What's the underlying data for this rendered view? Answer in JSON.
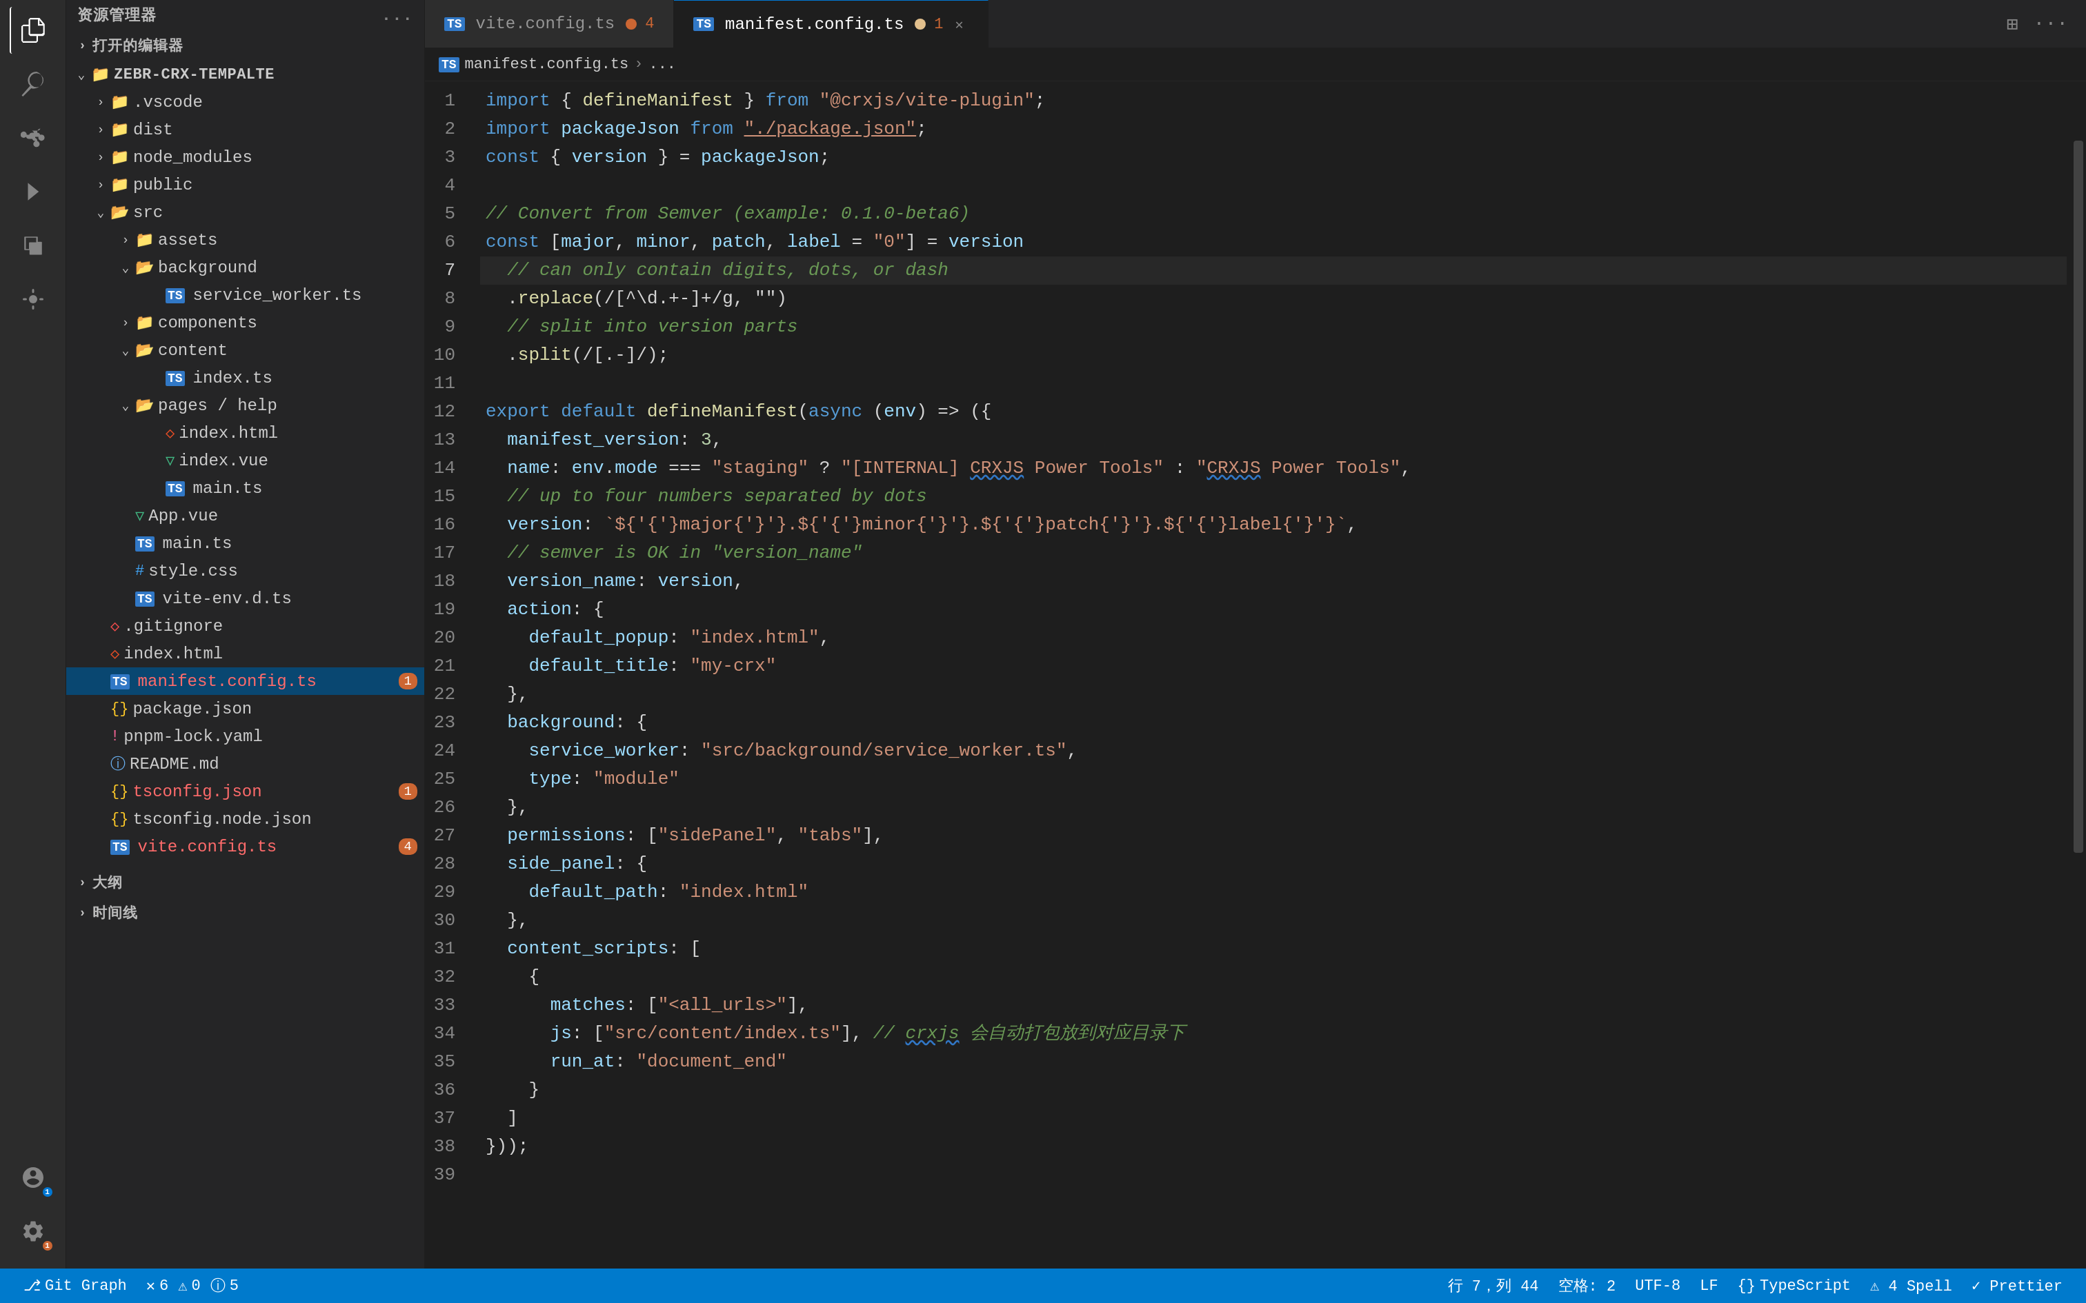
{
  "titleBar": {
    "explorerLabel": "资源管理器",
    "moreButton": "...",
    "openedFilesLabel": "打开的编辑器"
  },
  "sidebar": {
    "rootName": "ZEBR-CRX-TEMPALTE",
    "items": [
      {
        "id": "vscode",
        "label": ".vscode",
        "type": "folder",
        "indent": 1,
        "open": false
      },
      {
        "id": "dist",
        "label": "dist",
        "type": "folder",
        "indent": 1,
        "open": false
      },
      {
        "id": "node_modules",
        "label": "node_modules",
        "type": "folder",
        "indent": 1,
        "open": false
      },
      {
        "id": "public",
        "label": "public",
        "type": "folder",
        "indent": 1,
        "open": false
      },
      {
        "id": "src",
        "label": "src",
        "type": "folder",
        "indent": 1,
        "open": true
      },
      {
        "id": "assets",
        "label": "assets",
        "type": "folder",
        "indent": 2,
        "open": false
      },
      {
        "id": "background",
        "label": "background",
        "type": "folder",
        "indent": 2,
        "open": true
      },
      {
        "id": "service_worker.ts",
        "label": "service_worker.ts",
        "type": "ts",
        "indent": 3,
        "open": false
      },
      {
        "id": "components",
        "label": "components",
        "type": "folder",
        "indent": 2,
        "open": false
      },
      {
        "id": "content",
        "label": "content",
        "type": "folder",
        "indent": 2,
        "open": true
      },
      {
        "id": "index.ts",
        "label": "index.ts",
        "type": "ts",
        "indent": 3,
        "open": false
      },
      {
        "id": "pages_help",
        "label": "pages / help",
        "type": "folder",
        "indent": 2,
        "open": true
      },
      {
        "id": "index.html_pages",
        "label": "index.html",
        "type": "html",
        "indent": 3,
        "open": false
      },
      {
        "id": "index.vue",
        "label": "index.vue",
        "type": "vue",
        "indent": 3,
        "open": false
      },
      {
        "id": "main.ts_help",
        "label": "main.ts",
        "type": "ts",
        "indent": 3,
        "open": false
      },
      {
        "id": "App.vue",
        "label": "App.vue",
        "type": "vue",
        "indent": 2,
        "open": false
      },
      {
        "id": "main.ts",
        "label": "main.ts",
        "type": "ts",
        "indent": 2,
        "open": false
      },
      {
        "id": "style.css",
        "label": "style.css",
        "type": "css",
        "indent": 2,
        "open": false
      },
      {
        "id": "vite-env.d.ts",
        "label": "vite-env.d.ts",
        "type": "ts",
        "indent": 2,
        "open": false
      },
      {
        "id": ".gitignore",
        "label": ".gitignore",
        "type": "git",
        "indent": 1,
        "open": false
      },
      {
        "id": "index.html",
        "label": "index.html",
        "type": "html",
        "indent": 1,
        "open": false
      },
      {
        "id": "manifest.config.ts",
        "label": "manifest.config.ts",
        "type": "ts",
        "indent": 1,
        "open": false,
        "active": true,
        "badge": "1"
      },
      {
        "id": "package.json",
        "label": "package.json",
        "type": "json",
        "indent": 1,
        "open": false
      },
      {
        "id": "pnpm-lock.yaml",
        "label": "pnpm-lock.yaml",
        "type": "yaml",
        "indent": 1,
        "open": false
      },
      {
        "id": "README.md",
        "label": "README.md",
        "type": "info",
        "indent": 1,
        "open": false
      },
      {
        "id": "tsconfig.json",
        "label": "tsconfig.json",
        "type": "json",
        "indent": 1,
        "open": false,
        "badge": "1"
      },
      {
        "id": "tsconfig.node.json",
        "label": "tsconfig.node.json",
        "type": "json",
        "indent": 1,
        "open": false
      },
      {
        "id": "vite.config.ts",
        "label": "vite.config.ts",
        "type": "ts",
        "indent": 1,
        "open": false,
        "badge": "4"
      }
    ],
    "outline": "大纲",
    "timeline": "时间线"
  },
  "tabs": [
    {
      "id": "vite.config.ts",
      "label": "vite.config.ts",
      "type": "ts",
      "badge": "4",
      "active": false
    },
    {
      "id": "manifest.config.ts",
      "label": "manifest.config.ts",
      "type": "ts",
      "badge": "1",
      "active": true,
      "modified": true
    }
  ],
  "breadcrumb": {
    "parts": [
      "TS manifest.config.ts",
      ">",
      "..."
    ]
  },
  "editor": {
    "lines": [
      {
        "num": 1,
        "tokens": [
          {
            "t": "kw",
            "v": "import"
          },
          {
            "t": "op",
            "v": " { "
          },
          {
            "t": "fn",
            "v": "defineManifest"
          },
          {
            "t": "op",
            "v": " } "
          },
          {
            "t": "kw",
            "v": "from"
          },
          {
            "t": "op",
            "v": " "
          },
          {
            "t": "str",
            "v": "\"@crxjs/vite-plugin\""
          },
          {
            "t": "op",
            "v": ";"
          }
        ]
      },
      {
        "num": 2,
        "tokens": [
          {
            "t": "kw",
            "v": "import"
          },
          {
            "t": "op",
            "v": " "
          },
          {
            "t": "var",
            "v": "packageJson"
          },
          {
            "t": "op",
            "v": " "
          },
          {
            "t": "kw",
            "v": "from"
          },
          {
            "t": "op",
            "v": " "
          },
          {
            "t": "str",
            "v": "\"./package.json\""
          },
          {
            "t": "op",
            "v": ";"
          }
        ]
      },
      {
        "num": 3,
        "tokens": [
          {
            "t": "kw",
            "v": "const"
          },
          {
            "t": "op",
            "v": " { "
          },
          {
            "t": "var",
            "v": "version"
          },
          {
            "t": "op",
            "v": " } = "
          },
          {
            "t": "var",
            "v": "packageJson"
          },
          {
            "t": "op",
            "v": ";"
          }
        ]
      },
      {
        "num": 4,
        "tokens": []
      },
      {
        "num": 5,
        "tokens": [
          {
            "t": "cmt",
            "v": "// Convert from Semver (example: 0.1.0-beta6)"
          }
        ]
      },
      {
        "num": 6,
        "tokens": [
          {
            "t": "kw",
            "v": "const"
          },
          {
            "t": "op",
            "v": " ["
          },
          {
            "t": "var",
            "v": "major"
          },
          {
            "t": "op",
            "v": ", "
          },
          {
            "t": "var",
            "v": "minor"
          },
          {
            "t": "op",
            "v": ", "
          },
          {
            "t": "var",
            "v": "patch"
          },
          {
            "t": "op",
            "v": ", "
          },
          {
            "t": "var",
            "v": "label"
          },
          {
            "t": "op",
            "v": " = "
          },
          {
            "t": "str",
            "v": "\"0\""
          },
          {
            "t": "op",
            "v": "] = "
          },
          {
            "t": "var",
            "v": "version"
          }
        ]
      },
      {
        "num": 7,
        "tokens": [
          {
            "t": "cmt",
            "v": "  // can only contain digits, dots, or dash"
          }
        ],
        "highlighted": true
      },
      {
        "num": 8,
        "tokens": [
          {
            "t": "op",
            "v": "  ."
          },
          {
            "t": "fn",
            "v": "replace"
          },
          {
            "t": "op",
            "v": "(/[^\\d."
          },
          {
            "t": "op",
            "v": "-"
          },
          {
            "t": "op",
            "v": "]+/g, \"\")"
          }
        ]
      },
      {
        "num": 9,
        "tokens": [
          {
            "t": "cmt",
            "v": "  // split into version parts"
          }
        ]
      },
      {
        "num": 10,
        "tokens": [
          {
            "t": "op",
            "v": "  ."
          },
          {
            "t": "fn",
            "v": "split"
          },
          {
            "t": "op",
            "v": "(/[."
          },
          {
            "t": "op",
            "v": "-"
          },
          {
            "t": "op",
            "v": "]/);"
          }
        ]
      },
      {
        "num": 11,
        "tokens": []
      },
      {
        "num": 12,
        "tokens": [
          {
            "t": "kw",
            "v": "export"
          },
          {
            "t": "op",
            "v": " "
          },
          {
            "t": "kw",
            "v": "default"
          },
          {
            "t": "op",
            "v": " "
          },
          {
            "t": "fn",
            "v": "defineManifest"
          },
          {
            "t": "op",
            "v": "("
          },
          {
            "t": "kw",
            "v": "async"
          },
          {
            "t": "op",
            "v": " ("
          },
          {
            "t": "var",
            "v": "env"
          },
          {
            "t": "op",
            "v": ") => ({"
          }
        ]
      },
      {
        "num": 13,
        "tokens": [
          {
            "t": "op",
            "v": "  "
          },
          {
            "t": "prop",
            "v": "manifest_version"
          },
          {
            "t": "op",
            "v": ": "
          },
          {
            "t": "num",
            "v": "3"
          },
          {
            "t": "op",
            "v": ","
          }
        ]
      },
      {
        "num": 14,
        "tokens": [
          {
            "t": "op",
            "v": "  "
          },
          {
            "t": "prop",
            "v": "name"
          },
          {
            "t": "op",
            "v": ": "
          },
          {
            "t": "var",
            "v": "env"
          },
          {
            "t": "op",
            "v": "."
          },
          {
            "t": "var",
            "v": "mode"
          },
          {
            "t": "op",
            "v": " === "
          },
          {
            "t": "str",
            "v": "\"staging\""
          },
          {
            "t": "op",
            "v": " ? "
          },
          {
            "t": "str",
            "v": "\"[INTERNAL] CRXJS Power Tools\""
          },
          {
            "t": "op",
            "v": " : "
          },
          {
            "t": "str",
            "v": "\"CRXJS Power Tools\""
          },
          {
            "t": "op",
            "v": ","
          }
        ]
      },
      {
        "num": 15,
        "tokens": [
          {
            "t": "cmt",
            "v": "  // up to four numbers separated by dots"
          }
        ]
      },
      {
        "num": 16,
        "tokens": [
          {
            "t": "op",
            "v": "  "
          },
          {
            "t": "prop",
            "v": "version"
          },
          {
            "t": "op",
            "v": ": "
          },
          {
            "t": "template",
            "v": "`${major}.${minor}.${patch}.${label}`"
          },
          {
            "t": "op",
            "v": ","
          }
        ]
      },
      {
        "num": 17,
        "tokens": [
          {
            "t": "cmt",
            "v": "  // semver is OK in \"version_name\""
          }
        ]
      },
      {
        "num": 18,
        "tokens": [
          {
            "t": "op",
            "v": "  "
          },
          {
            "t": "prop",
            "v": "version_name"
          },
          {
            "t": "op",
            "v": ": "
          },
          {
            "t": "var",
            "v": "version"
          },
          {
            "t": "op",
            "v": ","
          }
        ]
      },
      {
        "num": 19,
        "tokens": [
          {
            "t": "op",
            "v": "  "
          },
          {
            "t": "prop",
            "v": "action"
          },
          {
            "t": "op",
            "v": ": {"
          }
        ]
      },
      {
        "num": 20,
        "tokens": [
          {
            "t": "op",
            "v": "    "
          },
          {
            "t": "prop",
            "v": "default_popup"
          },
          {
            "t": "op",
            "v": ": "
          },
          {
            "t": "str",
            "v": "\"index.html\""
          },
          {
            "t": "op",
            "v": ","
          }
        ]
      },
      {
        "num": 21,
        "tokens": [
          {
            "t": "op",
            "v": "    "
          },
          {
            "t": "prop",
            "v": "default_title"
          },
          {
            "t": "op",
            "v": ": "
          },
          {
            "t": "str",
            "v": "\"my-crx\""
          }
        ]
      },
      {
        "num": 22,
        "tokens": [
          {
            "t": "op",
            "v": "  },"
          }
        ]
      },
      {
        "num": 23,
        "tokens": [
          {
            "t": "op",
            "v": "  "
          },
          {
            "t": "prop",
            "v": "background"
          },
          {
            "t": "op",
            "v": ": {"
          }
        ]
      },
      {
        "num": 24,
        "tokens": [
          {
            "t": "op",
            "v": "    "
          },
          {
            "t": "prop",
            "v": "service_worker"
          },
          {
            "t": "op",
            "v": ": "
          },
          {
            "t": "str",
            "v": "\"src/background/service_worker.ts\""
          },
          {
            "t": "op",
            "v": ","
          }
        ]
      },
      {
        "num": 25,
        "tokens": [
          {
            "t": "op",
            "v": "    "
          },
          {
            "t": "prop",
            "v": "type"
          },
          {
            "t": "op",
            "v": ": "
          },
          {
            "t": "str",
            "v": "\"module\""
          }
        ]
      },
      {
        "num": 26,
        "tokens": [
          {
            "t": "op",
            "v": "  },"
          }
        ]
      },
      {
        "num": 27,
        "tokens": [
          {
            "t": "op",
            "v": "  "
          },
          {
            "t": "prop",
            "v": "permissions"
          },
          {
            "t": "op",
            "v": ": ["
          },
          {
            "t": "str",
            "v": "\"sidePanel\""
          },
          {
            "t": "op",
            "v": ", "
          },
          {
            "t": "str",
            "v": "\"tabs\""
          },
          {
            "t": "op",
            "v": "],"
          }
        ]
      },
      {
        "num": 28,
        "tokens": [
          {
            "t": "op",
            "v": "  "
          },
          {
            "t": "prop",
            "v": "side_panel"
          },
          {
            "t": "op",
            "v": ": {"
          }
        ]
      },
      {
        "num": 29,
        "tokens": [
          {
            "t": "op",
            "v": "    "
          },
          {
            "t": "prop",
            "v": "default_path"
          },
          {
            "t": "op",
            "v": ": "
          },
          {
            "t": "str",
            "v": "\"index.html\""
          }
        ]
      },
      {
        "num": 30,
        "tokens": [
          {
            "t": "op",
            "v": "  },"
          }
        ]
      },
      {
        "num": 31,
        "tokens": [
          {
            "t": "op",
            "v": "  "
          },
          {
            "t": "prop",
            "v": "content_scripts"
          },
          {
            "t": "op",
            "v": ": ["
          }
        ]
      },
      {
        "num": 32,
        "tokens": [
          {
            "t": "op",
            "v": "    {"
          }
        ]
      },
      {
        "num": 33,
        "tokens": [
          {
            "t": "op",
            "v": "      "
          },
          {
            "t": "prop",
            "v": "matches"
          },
          {
            "t": "op",
            "v": ": ["
          },
          {
            "t": "str",
            "v": "\"<all_urls>\""
          },
          {
            "t": "op",
            "v": "],"
          }
        ]
      },
      {
        "num": 34,
        "tokens": [
          {
            "t": "op",
            "v": "      "
          },
          {
            "t": "prop",
            "v": "js"
          },
          {
            "t": "op",
            "v": ": ["
          },
          {
            "t": "str",
            "v": "\"src/content/index.ts\""
          },
          {
            "t": "op",
            "v": "], "
          },
          {
            "t": "cmt",
            "v": "// crxjs 会自动打包放到对应目录下"
          }
        ]
      },
      {
        "num": 35,
        "tokens": [
          {
            "t": "op",
            "v": "      "
          },
          {
            "t": "prop",
            "v": "run_at"
          },
          {
            "t": "op",
            "v": ": "
          },
          {
            "t": "str",
            "v": "\"document_end\""
          }
        ]
      },
      {
        "num": 36,
        "tokens": [
          {
            "t": "op",
            "v": "    }"
          }
        ]
      },
      {
        "num": 37,
        "tokens": [
          {
            "t": "op",
            "v": "  ]"
          }
        ]
      },
      {
        "num": 38,
        "tokens": [
          {
            "t": "op",
            "v": "}));"
          }
        ]
      },
      {
        "num": 39,
        "tokens": []
      }
    ]
  },
  "statusBar": {
    "branch": "Git Graph",
    "errors": "6",
    "warnings": "0",
    "info": "5",
    "position": "行 7，列 44",
    "spaces": "空格: 2",
    "encoding": "UTF-8",
    "lineEnding": "LF",
    "language": "TypeScript",
    "issues": "⚠ 4 Spell",
    "formatter": "✓ Prettier"
  }
}
